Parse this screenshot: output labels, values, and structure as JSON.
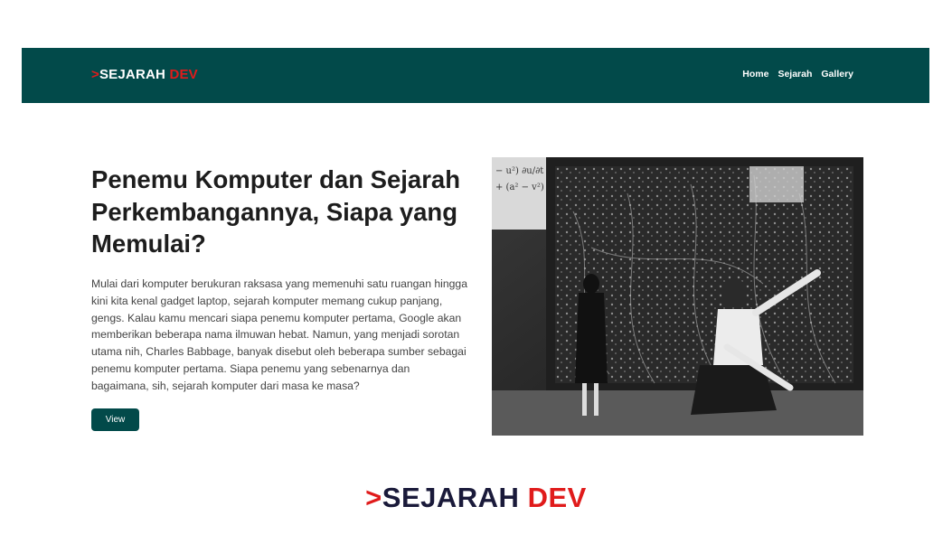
{
  "navbar": {
    "brand_chevron": ">",
    "brand_main": "SEJARAH",
    "brand_accent": "DEV",
    "links": [
      "Home",
      "Sejarah",
      "Gallery"
    ]
  },
  "hero": {
    "title": "Penemu Komputer dan Sejarah Perkembangannya, Siapa yang Memulai?",
    "body": "Mulai dari komputer berukuran raksasa yang memenuhi satu ruangan hingga kini kita kenal gadget laptop, sejarah komputer memang cukup panjang, gengs. Kalau kamu mencari siapa penemu komputer pertama, Google akan memberikan beberapa nama ilmuwan hebat. Namun, yang menjadi sorotan utama nih, Charles Babbage, banyak disebut oleh beberapa sumber sebagai penemu komputer pertama. Siapa penemu yang sebenarnya dan bagaimana, sih, sejarah komputer dari masa ke masa?",
    "button_label": "View"
  },
  "footer": {
    "brand_chevron": ">",
    "brand_main": "SEJARAH",
    "brand_accent": "DEV"
  },
  "colors": {
    "primary": "#024a4a",
    "accent": "#e01b1b"
  },
  "image": {
    "subject": "black-and-white photo of early computer with operators"
  }
}
